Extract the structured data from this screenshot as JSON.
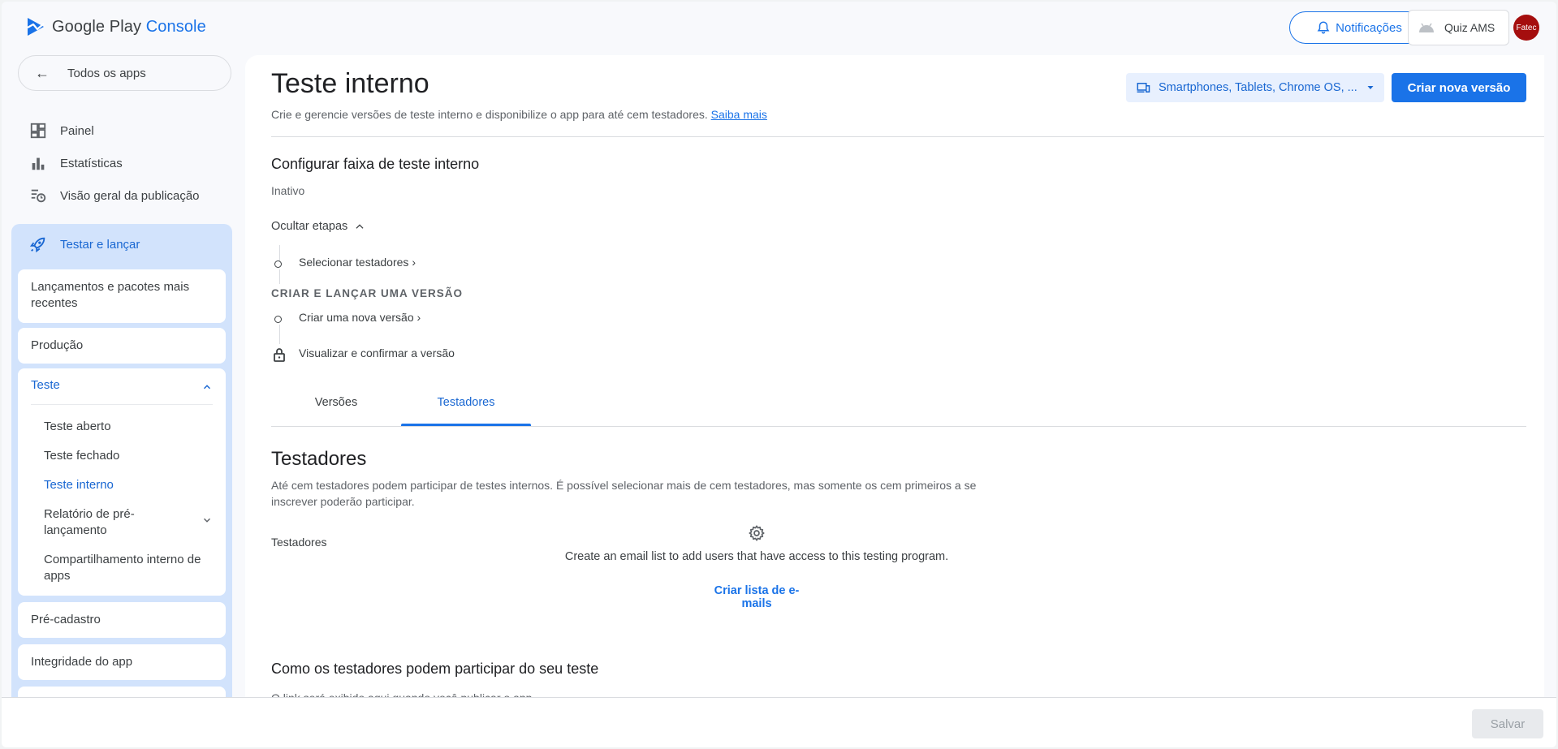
{
  "header": {
    "logo_main": "Google Play",
    "logo_accent": "Console",
    "notifications_label": "Notificações",
    "app_name": "Quiz AMS",
    "avatar_text": "Fatec"
  },
  "sidebar": {
    "back_label": "Todos os apps",
    "nav": [
      {
        "label": "Painel",
        "icon": "dashboard-icon"
      },
      {
        "label": "Estatísticas",
        "icon": "bar-chart-icon"
      },
      {
        "label": "Visão geral da publicação",
        "icon": "publishing-overview-icon"
      }
    ],
    "group_label": "Testar e lançar",
    "cards": {
      "latest": "Lançamentos e pacotes mais recentes",
      "production": "Produção",
      "test": "Teste",
      "precadastro": "Pré-cadastro",
      "integrity": "Integridade do app"
    },
    "test_items": [
      "Teste aberto",
      "Teste fechado",
      "Teste interno",
      "Relatório de pré-lançamento",
      "Compartilhamento interno de apps"
    ]
  },
  "main": {
    "title": "Teste interno",
    "description": "Crie e gerencie versões de teste interno e disponibilize o app para até cem testadores.",
    "learn_more": "Saiba mais",
    "device_select": "Smartphones, Tablets, Chrome OS, ...",
    "create_release_button": "Criar nova versão",
    "configure_title": "Configurar faixa de teste interno",
    "status": "Inativo",
    "hide_steps": "Ocultar etapas",
    "step_select_testers": "Selecionar testadores",
    "create_section_caps": "CRIAR E LANÇAR UMA VERSÃO",
    "step_create_release": "Criar uma nova versão",
    "step_review": "Visualizar e confirmar a versão",
    "tabs": [
      "Versões",
      "Testadores"
    ],
    "testers_title": "Testadores",
    "testers_desc": "Até cem testadores podem participar de testes internos. É possível selecionar mais de cem testadores, mas somente os cem primeiros a se inscrever poderão participar.",
    "testers_label": "Testadores",
    "empty_message": "Create an email list to add users that have access to this testing program.",
    "create_email_list": "Criar lista de e-mails",
    "how_title": "Como os testadores podem participar do seu teste",
    "how_desc": "O link será exibido aqui quando você publicar o app."
  },
  "footer": {
    "save_label": "Salvar"
  },
  "colors": {
    "primary": "#1a73e8",
    "active_group_bg": "#d2e3fc",
    "avatar_bg": "#a50e0e"
  }
}
